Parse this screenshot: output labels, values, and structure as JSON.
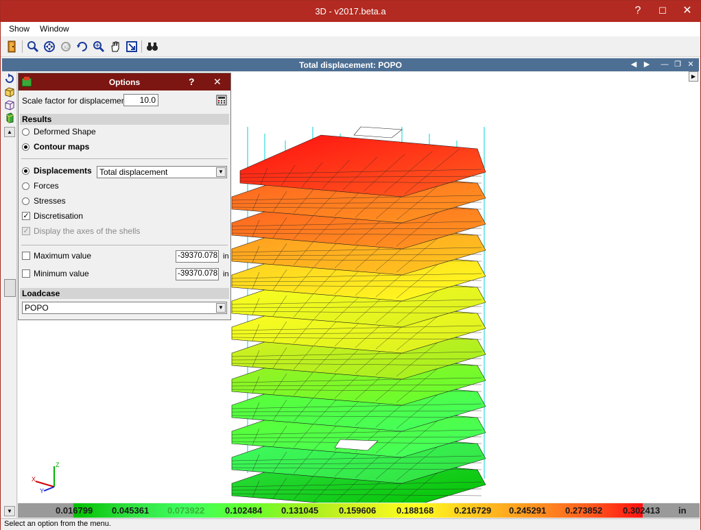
{
  "window": {
    "title": "3D  - v2017.beta.a",
    "help_label": "?",
    "minimize_label": "—",
    "maximize_label": "☐",
    "close_label": "✕"
  },
  "menu": {
    "items": [
      "Show",
      "Window"
    ]
  },
  "toolbar": {
    "icons": [
      "exit-icon",
      "zoom-previous-icon",
      "zoom-all-icon",
      "zoom-window-icon",
      "rotate-icon",
      "zoom-in-icon",
      "pan-hand-icon",
      "zoom-extents-icon",
      "find-binoculars-icon"
    ]
  },
  "document": {
    "title": "Total displacement: POPO",
    "prev_label": "◀",
    "next_label": "▶",
    "minimize_label": "—",
    "restore_label": "❐",
    "close_label": "✕"
  },
  "options": {
    "title": "Options",
    "help_label": "?",
    "close_label": "✕",
    "scale_label": "Scale factor for displacements",
    "scale_value": "10.0",
    "results_header": "Results",
    "deformed_label": "Deformed Shape",
    "contour_label": "Contour maps",
    "displacements_label": "Displacements",
    "displacement_type": "Total displacement",
    "forces_label": "Forces",
    "stresses_label": "Stresses",
    "discretisation_label": "Discretisation",
    "axes_label": "Display the axes of the shells",
    "max_label": "Maximum value",
    "max_value": "-39370.078",
    "min_label": "Minimum value",
    "min_value": "-39370.078",
    "unit": "in",
    "loadcase_header": "Loadcase",
    "loadcase_value": "POPO"
  },
  "legend": {
    "values": [
      "0.016799",
      "0.045361",
      "0.073922",
      "0.102484",
      "0.131045",
      "0.159606",
      "0.188168",
      "0.216729",
      "0.245291",
      "0.273852",
      "0.302413"
    ],
    "unit": "in",
    "colors": [
      "#00c000",
      "#30e040",
      "#40ff60",
      "#60ff30",
      "#a0f020",
      "#d8f020",
      "#ffff20",
      "#ffc820",
      "#ff9820",
      "#ff6020",
      "#ff1010"
    ]
  },
  "status": {
    "text": "Select an option from the menu."
  }
}
